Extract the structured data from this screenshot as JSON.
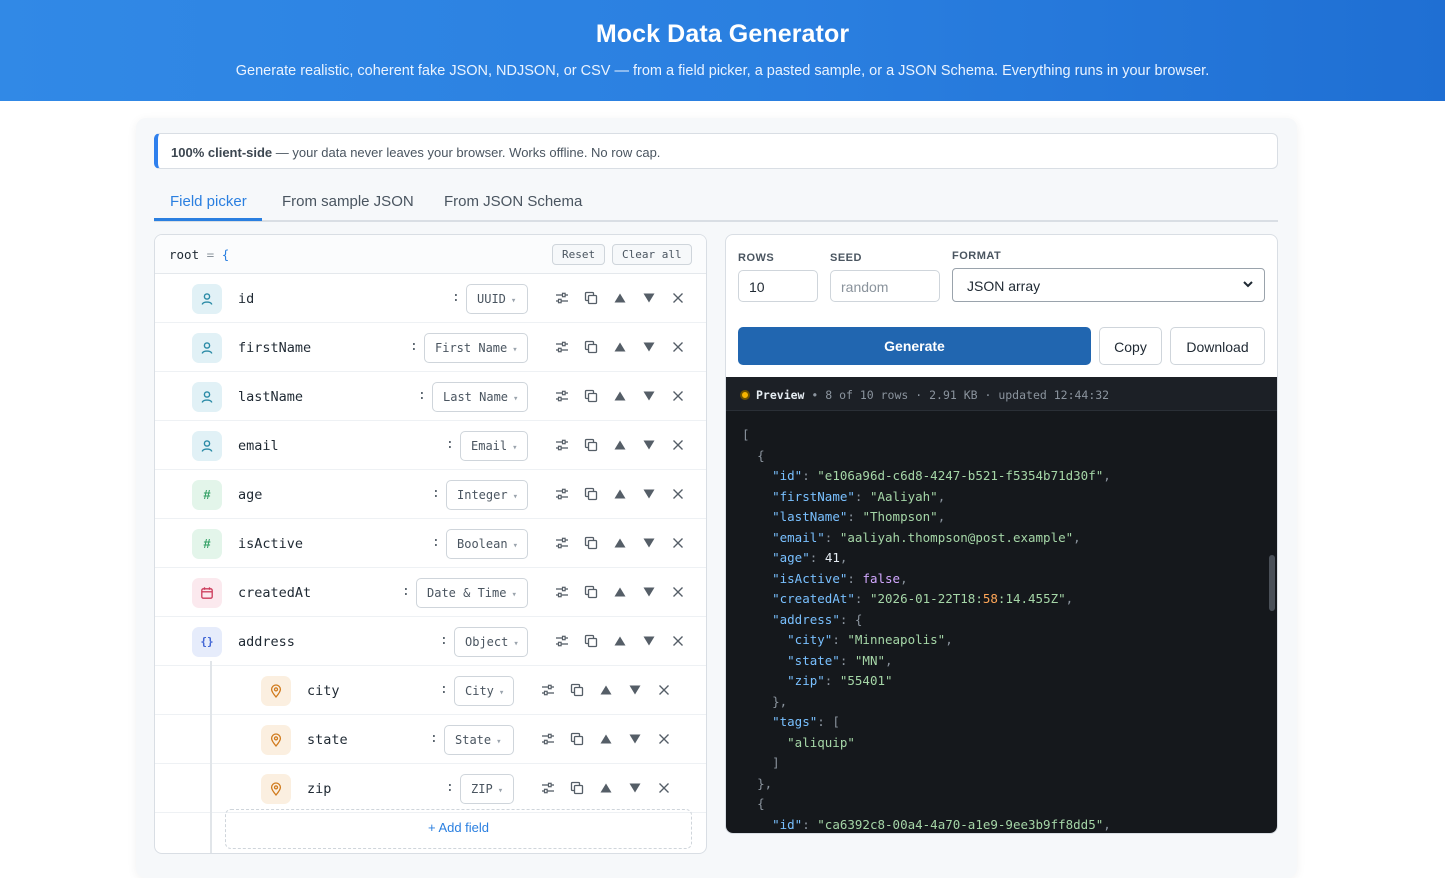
{
  "header": {
    "title": "Mock Data Generator",
    "subtitle": "Generate realistic, coherent fake JSON, NDJSON, or CSV — from a field picker, a pasted sample, or a JSON Schema. Everything runs in your browser."
  },
  "notice": {
    "strong": "100% client-side",
    "text": " — your data never leaves your browser. Works offline. No row cap."
  },
  "tabs": [
    {
      "label": "Field picker",
      "active": true
    },
    {
      "label": "From sample JSON",
      "active": false
    },
    {
      "label": "From JSON Schema",
      "active": false
    }
  ],
  "field_panel": {
    "root_label": "root",
    "root_eq": "=",
    "root_brace": "{",
    "reset_label": "Reset",
    "clear_label": "Clear all",
    "add_field_label": "+ Add field",
    "colon": ":",
    "fields": [
      {
        "name": "id",
        "type": "UUID",
        "icon": "person-icon"
      },
      {
        "name": "firstName",
        "type": "First Name",
        "icon": "person-icon"
      },
      {
        "name": "lastName",
        "type": "Last Name",
        "icon": "person-icon"
      },
      {
        "name": "email",
        "type": "Email",
        "icon": "person-icon"
      },
      {
        "name": "age",
        "type": "Integer",
        "icon": "hash-icon"
      },
      {
        "name": "isActive",
        "type": "Boolean",
        "icon": "hash-icon"
      },
      {
        "name": "createdAt",
        "type": "Date & Time",
        "icon": "calendar-icon"
      },
      {
        "name": "address",
        "type": "Object",
        "icon": "object-icon"
      },
      {
        "name": "city",
        "type": "City",
        "icon": "map-pin-icon",
        "nested": true
      },
      {
        "name": "state",
        "type": "State",
        "icon": "map-pin-icon",
        "nested": true
      },
      {
        "name": "zip",
        "type": "ZIP",
        "icon": "map-pin-icon",
        "nested": true
      }
    ]
  },
  "controls": {
    "rows_label": "ROWS",
    "rows_value": "10",
    "seed_label": "SEED",
    "seed_placeholder": "random",
    "format_label": "FORMAT",
    "format_value": "JSON array",
    "generate_label": "Generate",
    "copy_label": "Copy",
    "download_label": "Download"
  },
  "preview": {
    "title": "Preview",
    "meta": " • 8 of 10 rows · 2.91 KB · updated 12:44:32",
    "status_color": "#f5b400"
  }
}
